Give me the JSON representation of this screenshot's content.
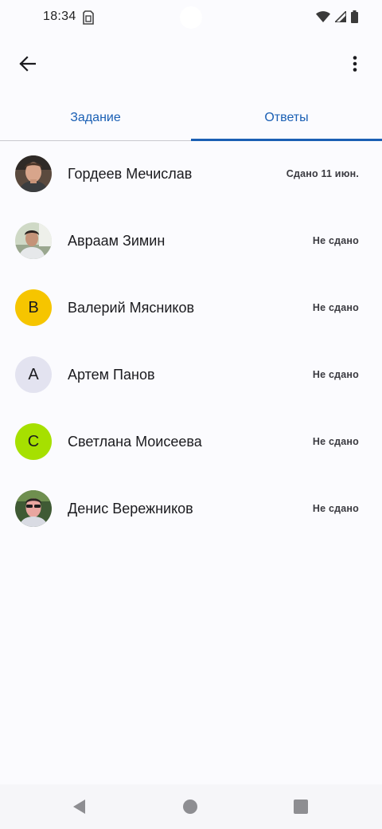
{
  "status_bar": {
    "time": "18:34",
    "icons": [
      "sim-card-icon",
      "wifi-icon",
      "cellular-signal-icon",
      "battery-icon"
    ]
  },
  "app_bar": {
    "back_icon": "arrow-back-icon",
    "more_icon": "more-vert-icon"
  },
  "tabs": [
    {
      "label": "Задание",
      "active": false
    },
    {
      "label": "Ответы",
      "active": true
    }
  ],
  "colors": {
    "accent": "#1a5fb4",
    "background": "#fbfbfe",
    "avatar_yellow": "#f6c500",
    "avatar_lavender": "#e3e3f0",
    "avatar_lime": "#a6e000"
  },
  "students": [
    {
      "name": "Гордеев Мечислав",
      "status": "Сдано 11 июн.",
      "avatar_type": "photo"
    },
    {
      "name": "Авраам Зимин",
      "status": "Не сдано",
      "avatar_type": "photo"
    },
    {
      "name": "Валерий Мясников",
      "status": "Не сдано",
      "avatar_type": "letter",
      "avatar_letter": "В",
      "avatar_color": "#f6c500"
    },
    {
      "name": "Артем Панов",
      "status": "Не сдано",
      "avatar_type": "letter",
      "avatar_letter": "А",
      "avatar_color": "#e3e3f0"
    },
    {
      "name": "Светлана Моисеева",
      "status": "Не сдано",
      "avatar_type": "letter",
      "avatar_letter": "С",
      "avatar_color": "#a6e000"
    },
    {
      "name": "Денис Вережников",
      "status": "Не сдано",
      "avatar_type": "photo"
    }
  ],
  "nav_bar": {
    "icons": [
      "nav-back-icon",
      "nav-home-icon",
      "nav-recents-icon"
    ]
  }
}
